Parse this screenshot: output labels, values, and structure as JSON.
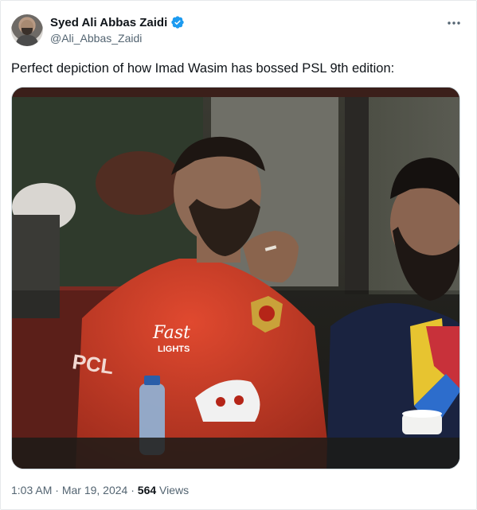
{
  "author": {
    "display_name": "Syed Ali Abbas Zaidi",
    "handle": "@Ali_Abbas_Zaidi",
    "verified_color": "#1d9bf0"
  },
  "tweet": {
    "text": "Perfect depiction of how Imad Wasim has bossed PSL 9th edition:",
    "media": {
      "jersey_sponsor": "Fast",
      "jersey_sponsor_sub": "LIGHTS",
      "sleeve_text": "PCL",
      "jersey_color": "#d8412c"
    }
  },
  "meta": {
    "time": "1:03 AM",
    "separator": "·",
    "date": "Mar 19, 2024",
    "views_count": "564",
    "views_label": "Views"
  },
  "icons": {
    "more": "more-horizontal-icon",
    "verified": "verified-badge-icon"
  }
}
